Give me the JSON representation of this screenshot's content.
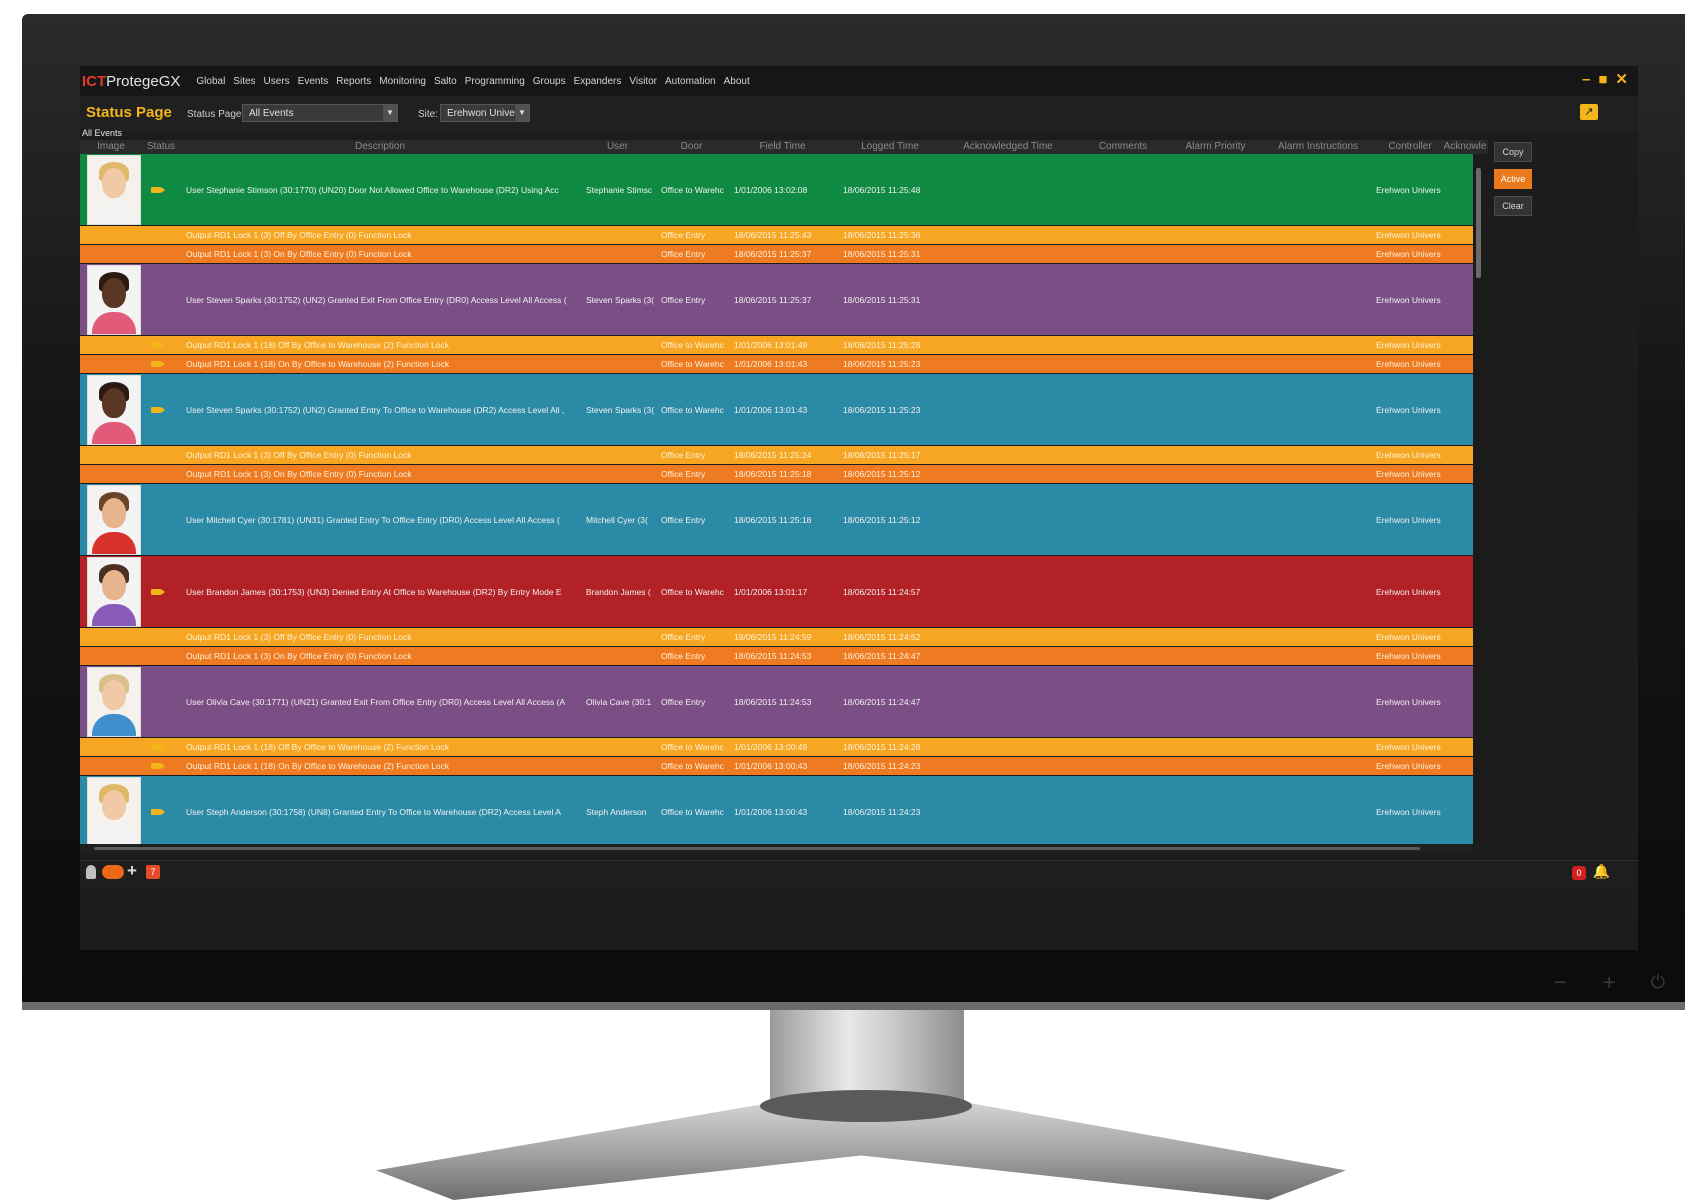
{
  "app": {
    "logo_brand": "ICT",
    "logo_product": "ProtegeGX",
    "menu": [
      "Global",
      "Sites",
      "Users",
      "Events",
      "Reports",
      "Monitoring",
      "Salto",
      "Programming",
      "Groups",
      "Expanders",
      "Visitor",
      "Automation",
      "About"
    ],
    "window_controls": {
      "minimize": "–",
      "maximize": "■",
      "close": "✕"
    }
  },
  "toolbar": {
    "title": "Status Page",
    "status_page_label": "Status Page:",
    "status_page_value": "All Events",
    "site_label": "Site:",
    "site_value": "Erehwon Univers"
  },
  "grid": {
    "caption": "All Events",
    "columns": [
      "Image",
      "Status",
      "Description",
      "User",
      "Door",
      "Field Time",
      "Logged Time",
      "Acknowledged Time",
      "Comments",
      "Alarm Priority",
      "Alarm Instructions",
      "Controller",
      "Acknowle"
    ],
    "side_buttons": [
      "Copy",
      "Active",
      "Clear"
    ],
    "rows": [
      {
        "type": "big",
        "color": "#0f8a43",
        "person": "woman-blonde",
        "status_icon": true,
        "description": "User Stephanie Stimson (30:1770) (UN20) Door Not Allowed Office to Warehouse (DR2) Using Acc",
        "user": "Stephanie Stimsc",
        "door": "Office to Warehc",
        "field_time": "1/01/2006 13:02:08",
        "logged_time": "18/06/2015 11:25:48",
        "controller": "Erehwon Univers"
      },
      {
        "type": "sub",
        "color": "#f6a623",
        "status_icon": false,
        "description": "Output RD1 Lock 1 (3) Off By Office Entry (0) Function Lock",
        "user": "",
        "door": "Office Entry",
        "field_time": "18/06/2015 11:25:43",
        "logged_time": "18/06/2015 11:25:36",
        "controller": "Erehwon Univers"
      },
      {
        "type": "sub",
        "color": "#ee7a22",
        "status_icon": false,
        "description": "Output RD1 Lock 1 (3) On By Office Entry (0) Function Lock",
        "user": "",
        "door": "Office Entry",
        "field_time": "18/06/2015 11:25:37",
        "logged_time": "18/06/2015 11:25:31",
        "controller": "Erehwon Univers"
      },
      {
        "type": "big",
        "color": "#7b4f86",
        "person": "man-dark",
        "status_icon": false,
        "description": "User Steven Sparks (30:1752) (UN2) Granted Exit From Office Entry (DR0) Access Level All Access (",
        "user": "Steven Sparks (3(",
        "door": "Office Entry",
        "field_time": "18/06/2015 11:25:37",
        "logged_time": "18/06/2015 11:25:31",
        "controller": "Erehwon Univers"
      },
      {
        "type": "sub",
        "color": "#f6a623",
        "status_icon": true,
        "description": "Output RD1 Lock 1 (18) Off By Office to Warehouse (2) Function Lock",
        "user": "",
        "door": "Office to Warehc",
        "field_time": "1/01/2006 13:01:49",
        "logged_time": "18/06/2015 11:25:28",
        "controller": "Erehwon Univers"
      },
      {
        "type": "sub",
        "color": "#ee7a22",
        "status_icon": true,
        "description": "Output RD1 Lock 1 (18) On By Office to Warehouse (2) Function Lock",
        "user": "",
        "door": "Office to Warehc",
        "field_time": "1/01/2006 13:01:43",
        "logged_time": "18/06/2015 11:25:23",
        "controller": "Erehwon Univers"
      },
      {
        "type": "big",
        "color": "#2b8aa6",
        "person": "man-dark",
        "status_icon": true,
        "description": "User Steven Sparks (30:1752) (UN2) Granted Entry To Office to Warehouse (DR2) Access Level All ,",
        "user": "Steven Sparks (3(",
        "door": "Office to Warehc",
        "field_time": "1/01/2006 13:01:43",
        "logged_time": "18/06/2015 11:25:23",
        "controller": "Erehwon Univers"
      },
      {
        "type": "sub",
        "color": "#f6a623",
        "status_icon": false,
        "description": "Output RD1 Lock 1 (3) Off By Office Entry (0) Function Lock",
        "user": "",
        "door": "Office Entry",
        "field_time": "18/06/2015 11:25:24",
        "logged_time": "18/06/2015 11:25:17",
        "controller": "Erehwon Univers"
      },
      {
        "type": "sub",
        "color": "#ee7a22",
        "status_icon": false,
        "description": "Output RD1 Lock 1 (3) On By Office Entry (0) Function Lock",
        "user": "",
        "door": "Office Entry",
        "field_time": "18/06/2015 11:25:18",
        "logged_time": "18/06/2015 11:25:12",
        "controller": "Erehwon Univers"
      },
      {
        "type": "big",
        "color": "#2b8aa6",
        "person": "man-red",
        "status_icon": false,
        "description": "User Mitchell Cyer (30:1781) (UN31) Granted Entry To Office Entry (DR0) Access Level All Access (",
        "user": "Mitchell Cyer (3(",
        "door": "Office Entry",
        "field_time": "18/06/2015 11:25:18",
        "logged_time": "18/06/2015 11:25:12",
        "controller": "Erehwon Univers"
      },
      {
        "type": "big",
        "color": "#b22126",
        "person": "man-purple",
        "status_icon": true,
        "description": "User Brandon James (30:1753) (UN3) Denied Entry At Office to Warehouse (DR2) By Entry Mode E",
        "user": "Brandon James (",
        "door": "Office to Warehc",
        "field_time": "1/01/2006 13:01:17",
        "logged_time": "18/06/2015 11:24:57",
        "controller": "Erehwon Univers"
      },
      {
        "type": "sub",
        "color": "#f6a623",
        "status_icon": false,
        "description": "Output RD1 Lock 1 (3) Off By Office Entry (0) Function Lock",
        "user": "",
        "door": "Office Entry",
        "field_time": "18/06/2015 11:24:59",
        "logged_time": "18/06/2015 11:24:52",
        "controller": "Erehwon Univers"
      },
      {
        "type": "sub",
        "color": "#ee7a22",
        "status_icon": false,
        "description": "Output RD1 Lock 1 (3) On By Office Entry (0) Function Lock",
        "user": "",
        "door": "Office Entry",
        "field_time": "18/06/2015 11:24:53",
        "logged_time": "18/06/2015 11:24:47",
        "controller": "Erehwon Univers"
      },
      {
        "type": "big",
        "color": "#7b4f86",
        "person": "woman-blonde2",
        "status_icon": false,
        "description": "User Olivia Cave (30:1771) (UN21) Granted Exit From Office Entry (DR0) Access Level All Access (A",
        "user": "Olivia Cave (30:1",
        "door": "Office Entry",
        "field_time": "18/06/2015 11:24:53",
        "logged_time": "18/06/2015 11:24:47",
        "controller": "Erehwon Univers"
      },
      {
        "type": "sub",
        "color": "#f6a623",
        "status_icon": true,
        "description": "Output RD1 Lock 1 (18) Off By Office to Warehouse (2) Function Lock",
        "user": "",
        "door": "Office to Warehc",
        "field_time": "1/01/2006 13:00:49",
        "logged_time": "18/06/2015 11:24:28",
        "controller": "Erehwon Univers"
      },
      {
        "type": "sub",
        "color": "#ee7a22",
        "status_icon": true,
        "description": "Output RD1 Lock 1 (18) On By Office to Warehouse (2) Function Lock",
        "user": "",
        "door": "Office to Warehc",
        "field_time": "1/01/2006 13:00:43",
        "logged_time": "18/06/2015 11:24:23",
        "controller": "Erehwon Univers"
      },
      {
        "type": "big",
        "color": "#2b8aa6",
        "person": "woman-blonde",
        "status_icon": true,
        "description": "User Steph Anderson (30:1758) (UN8) Granted Entry To Office to Warehouse (DR2) Access Level A",
        "user": "Steph Anderson",
        "door": "Office to Warehc",
        "field_time": "1/01/2006 13:00:43",
        "logged_time": "18/06/2015 11:24:23",
        "controller": "Erehwon Univers"
      }
    ]
  },
  "statusbar": {
    "count_badge": "7",
    "alert_badge": "0"
  },
  "colors": {
    "accent": "#f4b51a",
    "active_button": "#ea7a1d",
    "alert": "#d22020"
  }
}
